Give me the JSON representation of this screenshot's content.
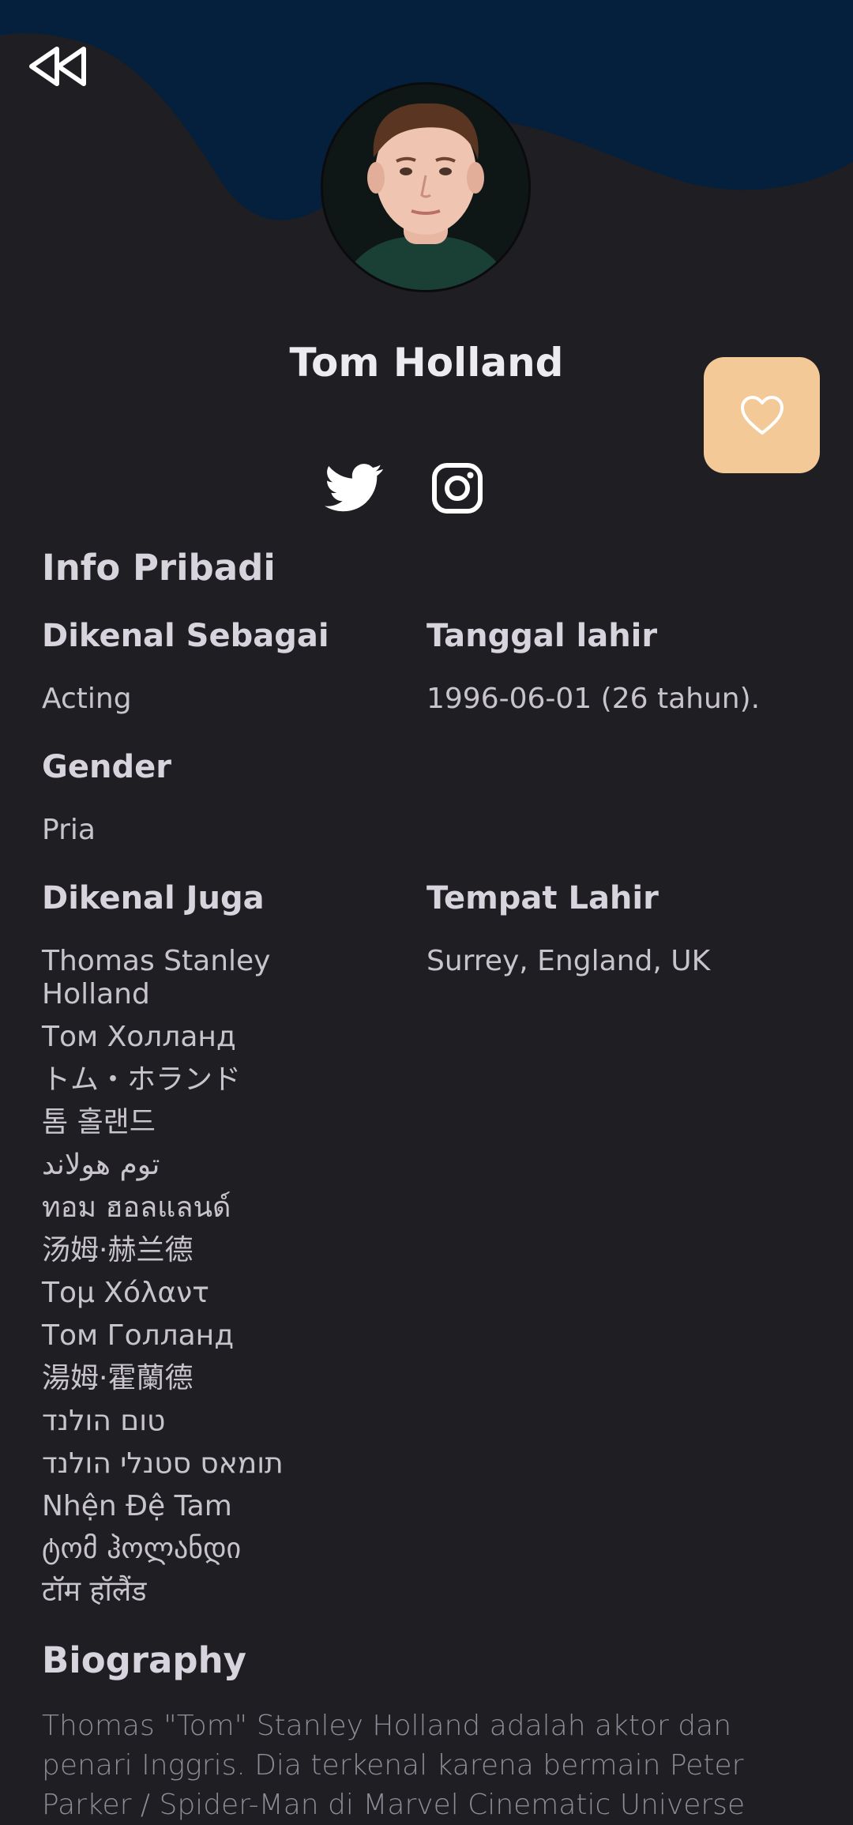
{
  "colors": {
    "background": "#1f1e22",
    "header_wave": "#04203d",
    "favorite_button": "#f3c998",
    "heart": "#ffffff"
  },
  "icons": {
    "back": "rewind-icon",
    "favorite": "heart-icon",
    "twitter": "twitter-icon",
    "instagram": "instagram-icon"
  },
  "profile": {
    "name": "Tom Holland",
    "avatar_alt": "Tom Holland"
  },
  "personal_info": {
    "title": "Info Pribadi",
    "known_for_label": "Dikenal Sebagai",
    "known_for_value": "Acting",
    "birthday_label": "Tanggal lahir",
    "birthday_value": "1996-06-01 (26 tahun).",
    "gender_label": "Gender",
    "gender_value": "Pria",
    "also_known_as_label": "Dikenal Juga",
    "place_of_birth_label": "Tempat Lahir",
    "place_of_birth_value": "Surrey, England, UK",
    "also_known_as": [
      "Thomas Stanley Holland",
      "Том Холланд",
      "トム・ホランド",
      "톰 홀랜드",
      "توم هولاند",
      "ทอม ฮอลแลนด์",
      "汤姆·赫兰德",
      "Τομ Χόλαντ",
      "Том Голланд",
      "湯姆·霍蘭德",
      "טום הולנד",
      "תומאס סטנלי הולנד",
      "Nhện Đệ Tam",
      "ტომ ჰოლანდი",
      "टॉम हॉलैंड"
    ]
  },
  "biography": {
    "title": "Biography",
    "text": "Thomas \"Tom\" Stanley Holland adalah aktor dan penari Inggris. Dia terkenal karena bermain Peter Parker / Spider-Man di Marvel Cinematic Universe"
  }
}
